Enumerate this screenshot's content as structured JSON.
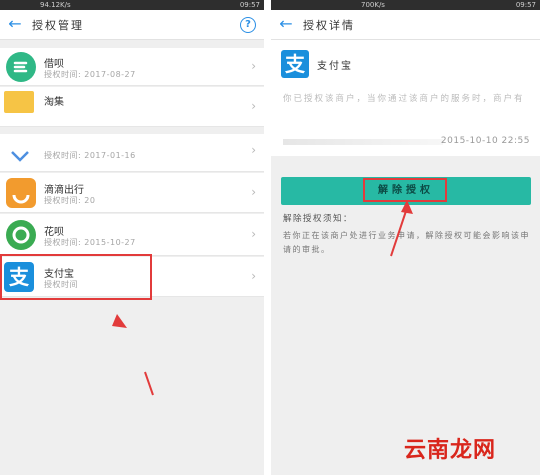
{
  "left": {
    "status_time": "09:57",
    "status_speed": "94.12K/s",
    "title": "授权管理",
    "help_label": "?",
    "back_label": "←",
    "items": [
      {
        "name": "借呗",
        "sub": "授权时间: 2017-08-27",
        "logo_color": "#2fb886",
        "logo_icon": "e-shape-icon"
      },
      {
        "name": "淘集",
        "sub": "",
        "logo_color": "#f6c445",
        "logo_icon": "folder-icon"
      },
      {
        "name": "",
        "sub": "授权时间: 2017-01-16",
        "logo_color": "#4d8fe0",
        "logo_icon": "chevron-v-icon"
      },
      {
        "name": "滴滴出行",
        "sub": "授权时间: 20",
        "logo_color": "#f29b2e",
        "logo_icon": "didi-icon"
      },
      {
        "name": "花呗",
        "sub": "授权时间: 2015-10-27",
        "logo_color": "#3aab52",
        "logo_icon": "huabei-icon"
      },
      {
        "name": "支付宝",
        "sub": "授权时间",
        "logo_color": "#1a8fdc",
        "logo_icon": "alipay-icon",
        "logo_char": "支"
      }
    ],
    "chevron": "›"
  },
  "right": {
    "status_time": "09:57",
    "status_speed": "700K/s",
    "title": "授权详情",
    "back_label": "←",
    "app_name": "支付宝",
    "logo_char": "支",
    "desc": "你已授权该商户，当你通过该商户的服务时，商户有",
    "date": "2015-10-10 22:55",
    "revoke_label": "解除授权",
    "notice_title": "解除授权须知：",
    "notice_body": "若你正在该商户处进行业务申请，解除授权可能会影响该申请的审批。"
  },
  "watermark": "云南龙网",
  "colors": {
    "accent": "#2b8fe5",
    "button": "#27b9a4",
    "highlight": "#e23b3b"
  }
}
